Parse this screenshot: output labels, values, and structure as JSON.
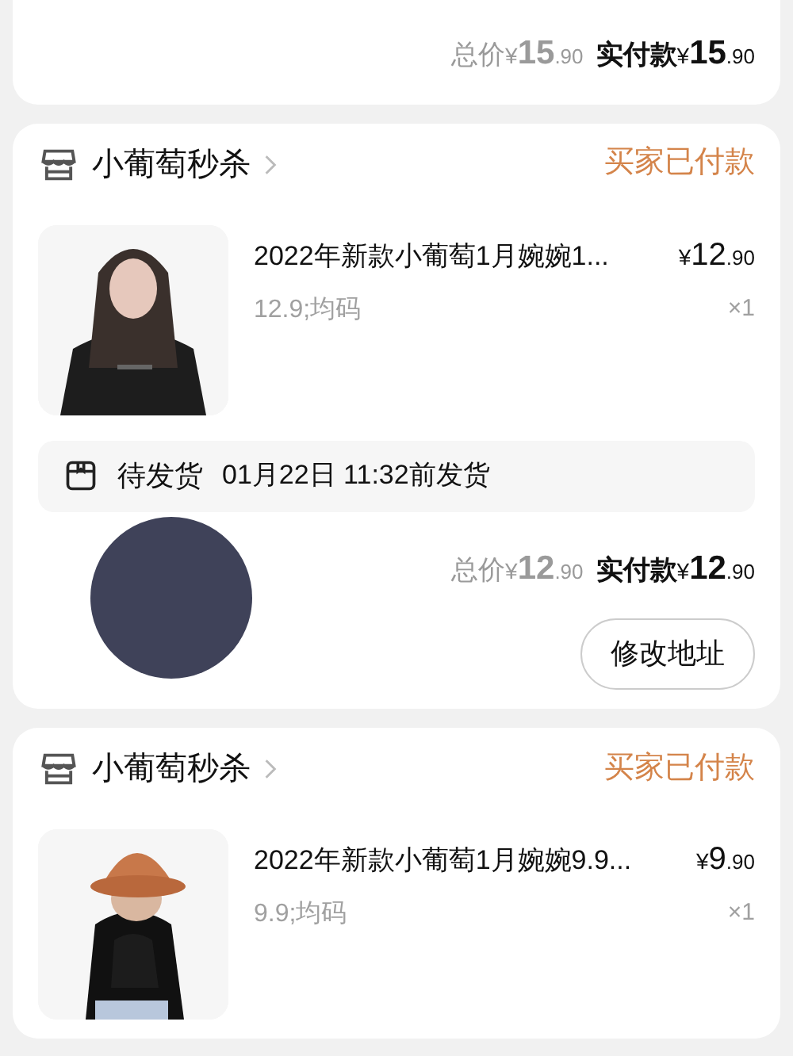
{
  "orders": [
    {
      "total_label": "总价",
      "total": "¥15.90",
      "paid_label": "实付款",
      "paid": "¥15.90"
    },
    {
      "shop": "小葡萄秒杀",
      "status": "买家已付款",
      "item": {
        "title": "2022年新款小葡萄1月婉婉1...",
        "price": "¥12.90",
        "spec": "12.9;均码",
        "qty": "×1"
      },
      "shipping": {
        "label": "待发货",
        "deadline": "01月22日 11:32前发货"
      },
      "total_label": "总价",
      "total": "¥12.90",
      "paid_label": "实付款",
      "paid": "¥12.90",
      "button": "修改地址"
    },
    {
      "shop": "小葡萄秒杀",
      "status": "买家已付款",
      "item": {
        "title": "2022年新款小葡萄1月婉婉9.9...",
        "price": "¥9.90",
        "spec": "9.9;均码",
        "qty": "×1"
      }
    }
  ]
}
